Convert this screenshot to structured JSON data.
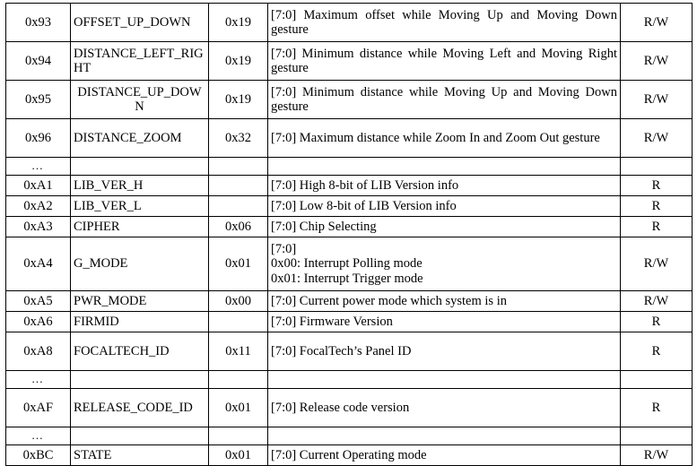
{
  "table": {
    "columns": [
      "Address",
      "Name",
      "Value",
      "Description",
      "Access"
    ],
    "rows": [
      {
        "kind": "data",
        "height": "tall",
        "addr": "0x93",
        "name": "OFFSET_UP_DOWN",
        "name_align": "left",
        "value": "0x19",
        "desc": "[7:0] Maximum offset while Moving Up and Moving Down gesture",
        "desc_justify": true,
        "rw": "R/W"
      },
      {
        "kind": "data",
        "height": "tall",
        "addr": "0x94",
        "name": "DISTANCE_LEFT_RIGHT",
        "name_align": "left",
        "value": "0x19",
        "desc": "[7:0] Minimum distance while Moving Left and Moving Right gesture",
        "desc_justify": true,
        "rw": "R/W"
      },
      {
        "kind": "data",
        "height": "tall",
        "addr": "0x95",
        "name": "DISTANCE_UP_DOWN",
        "name_align": "center",
        "value": "0x19",
        "desc": "[7:0] Minimum distance while Moving Up and Moving Down gesture",
        "desc_justify": true,
        "rw": "R/W"
      },
      {
        "kind": "data",
        "height": "tall",
        "addr": "0x96",
        "name": "DISTANCE_ZOOM",
        "name_align": "left",
        "value": "0x32",
        "desc": "[7:0] Maximum distance while Zoom In and Zoom Out gesture",
        "desc_justify": true,
        "rw": "R/W"
      },
      {
        "kind": "ellipsis",
        "height": "dots",
        "addr": "…",
        "name": "",
        "value": "",
        "desc": "",
        "rw": ""
      },
      {
        "kind": "data",
        "height": "short",
        "addr": "0xA1",
        "name": "LIB_VER_H",
        "name_align": "left",
        "value": "",
        "desc": "[7:0] High 8-bit of LIB Version info",
        "desc_justify": false,
        "rw": "R"
      },
      {
        "kind": "data",
        "height": "short",
        "addr": "0xA2",
        "name": "LIB_VER_L",
        "name_align": "left",
        "value": "",
        "desc": "[7:0] Low 8-bit of LIB Version info",
        "desc_justify": false,
        "rw": "R"
      },
      {
        "kind": "data",
        "height": "short",
        "addr": "0xA3",
        "name": "CIPHER",
        "name_align": "left",
        "value": "0x06",
        "desc": "[7:0] Chip Selecting",
        "desc_justify": false,
        "rw": "R"
      },
      {
        "kind": "multiline",
        "height": "triple",
        "addr": "0xA4",
        "name": "G_MODE",
        "name_align": "left",
        "value": "0x01",
        "desc_lines": [
          "[7:0]",
          "0x00: Interrupt Polling mode",
          "0x01: Interrupt Trigger mode"
        ],
        "rw": "R/W"
      },
      {
        "kind": "data",
        "height": "short",
        "addr": "0xA5",
        "name": "PWR_MODE",
        "name_align": "left",
        "value": "0x00",
        "desc": "[7:0] Current power mode which system is in",
        "desc_justify": false,
        "rw": "R/W"
      },
      {
        "kind": "data",
        "height": "short",
        "addr": "0xA6",
        "name": "FIRMID",
        "name_align": "left",
        "value": "",
        "desc": "[7:0] Firmware Version",
        "desc_justify": false,
        "rw": "R"
      },
      {
        "kind": "data",
        "height": "tall",
        "addr": "0xA8",
        "name": "FOCALTECH_ID",
        "name_align": "left",
        "value": "0x11",
        "desc": "[7:0] FocalTech’s Panel ID",
        "desc_justify": false,
        "rw": "R"
      },
      {
        "kind": "ellipsis",
        "height": "dots",
        "addr": "…",
        "name": "",
        "value": "",
        "desc": "",
        "rw": ""
      },
      {
        "kind": "data",
        "height": "tall",
        "addr": "0xAF",
        "name": "RELEASE_CODE_ID",
        "name_align": "left",
        "value": "0x01",
        "desc": "[7:0] Release code version",
        "desc_justify": false,
        "rw": "R"
      },
      {
        "kind": "ellipsis",
        "height": "dots",
        "addr": "…",
        "name": "",
        "value": "",
        "desc": "",
        "rw": ""
      },
      {
        "kind": "data",
        "height": "short",
        "addr": "0xBC",
        "name": "STATE",
        "name_align": "left",
        "value": "0x01",
        "desc": "[7:0] Current Operating mode",
        "desc_justify": false,
        "rw": "R/W"
      }
    ]
  }
}
